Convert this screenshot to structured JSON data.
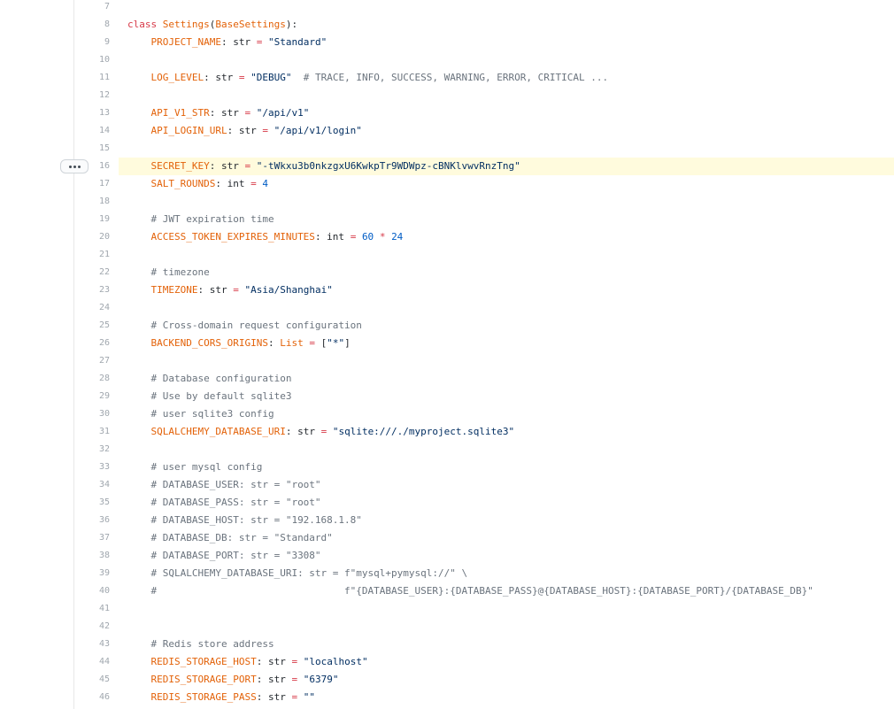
{
  "colors": {
    "keyword": "#d73a49",
    "entity": "#e36209",
    "string": "#032f62",
    "number": "#005cc5",
    "comment": "#6a737d",
    "highlight_bg": "#fffbdd",
    "line_number": "#a0a7ae"
  },
  "highlighted_line": 16,
  "line_actions": {
    "icon": "kebab-horizontal-icon"
  },
  "lines": [
    {
      "num": "7",
      "tokens": []
    },
    {
      "num": "8",
      "tokens": [
        {
          "t": "kw",
          "v": "class "
        },
        {
          "t": "ent",
          "v": "Settings"
        },
        {
          "t": "plain",
          "v": "("
        },
        {
          "t": "ent",
          "v": "BaseSettings"
        },
        {
          "t": "plain",
          "v": "):"
        }
      ]
    },
    {
      "num": "9",
      "tokens": [
        {
          "t": "plain",
          "v": "    "
        },
        {
          "t": "ent",
          "v": "PROJECT_NAME"
        },
        {
          "t": "plain",
          "v": ": str "
        },
        {
          "t": "op",
          "v": "="
        },
        {
          "t": "plain",
          "v": " "
        },
        {
          "t": "str",
          "v": "\"Standard\""
        }
      ]
    },
    {
      "num": "10",
      "tokens": []
    },
    {
      "num": "11",
      "tokens": [
        {
          "t": "plain",
          "v": "    "
        },
        {
          "t": "ent",
          "v": "LOG_LEVEL"
        },
        {
          "t": "plain",
          "v": ": str "
        },
        {
          "t": "op",
          "v": "="
        },
        {
          "t": "plain",
          "v": " "
        },
        {
          "t": "str",
          "v": "\"DEBUG\""
        },
        {
          "t": "plain",
          "v": "  "
        },
        {
          "t": "cmt",
          "v": "# TRACE, INFO, SUCCESS, WARNING, ERROR, CRITICAL ..."
        }
      ]
    },
    {
      "num": "12",
      "tokens": []
    },
    {
      "num": "13",
      "tokens": [
        {
          "t": "plain",
          "v": "    "
        },
        {
          "t": "ent",
          "v": "API_V1_STR"
        },
        {
          "t": "plain",
          "v": ": str "
        },
        {
          "t": "op",
          "v": "="
        },
        {
          "t": "plain",
          "v": " "
        },
        {
          "t": "str",
          "v": "\"/api/v1\""
        }
      ]
    },
    {
      "num": "14",
      "tokens": [
        {
          "t": "plain",
          "v": "    "
        },
        {
          "t": "ent",
          "v": "API_LOGIN_URL"
        },
        {
          "t": "plain",
          "v": ": str "
        },
        {
          "t": "op",
          "v": "="
        },
        {
          "t": "plain",
          "v": " "
        },
        {
          "t": "str",
          "v": "\"/api/v1/login\""
        }
      ]
    },
    {
      "num": "15",
      "tokens": []
    },
    {
      "num": "16",
      "tokens": [
        {
          "t": "plain",
          "v": "    "
        },
        {
          "t": "ent",
          "v": "SECRET_KEY"
        },
        {
          "t": "plain",
          "v": ": str "
        },
        {
          "t": "op",
          "v": "="
        },
        {
          "t": "plain",
          "v": " "
        },
        {
          "t": "str",
          "v": "\"-tWkxu3b0nkzgxU6KwkpTr9WDWpz-cBNKlvwvRnzTng\""
        }
      ]
    },
    {
      "num": "17",
      "tokens": [
        {
          "t": "plain",
          "v": "    "
        },
        {
          "t": "ent",
          "v": "SALT_ROUNDS"
        },
        {
          "t": "plain",
          "v": ": int "
        },
        {
          "t": "op",
          "v": "="
        },
        {
          "t": "plain",
          "v": " "
        },
        {
          "t": "num",
          "v": "4"
        }
      ]
    },
    {
      "num": "18",
      "tokens": []
    },
    {
      "num": "19",
      "tokens": [
        {
          "t": "plain",
          "v": "    "
        },
        {
          "t": "cmt",
          "v": "# JWT expiration time"
        }
      ]
    },
    {
      "num": "20",
      "tokens": [
        {
          "t": "plain",
          "v": "    "
        },
        {
          "t": "ent",
          "v": "ACCESS_TOKEN_EXPIRES_MINUTES"
        },
        {
          "t": "plain",
          "v": ": int "
        },
        {
          "t": "op",
          "v": "="
        },
        {
          "t": "plain",
          "v": " "
        },
        {
          "t": "num",
          "v": "60"
        },
        {
          "t": "plain",
          "v": " "
        },
        {
          "t": "op",
          "v": "*"
        },
        {
          "t": "plain",
          "v": " "
        },
        {
          "t": "num",
          "v": "24"
        }
      ]
    },
    {
      "num": "21",
      "tokens": []
    },
    {
      "num": "22",
      "tokens": [
        {
          "t": "plain",
          "v": "    "
        },
        {
          "t": "cmt",
          "v": "# timezone"
        }
      ]
    },
    {
      "num": "23",
      "tokens": [
        {
          "t": "plain",
          "v": "    "
        },
        {
          "t": "ent",
          "v": "TIMEZONE"
        },
        {
          "t": "plain",
          "v": ": str "
        },
        {
          "t": "op",
          "v": "="
        },
        {
          "t": "plain",
          "v": " "
        },
        {
          "t": "str",
          "v": "\"Asia/Shanghai\""
        }
      ]
    },
    {
      "num": "24",
      "tokens": []
    },
    {
      "num": "25",
      "tokens": [
        {
          "t": "plain",
          "v": "    "
        },
        {
          "t": "cmt",
          "v": "# Cross-domain request configuration"
        }
      ]
    },
    {
      "num": "26",
      "tokens": [
        {
          "t": "plain",
          "v": "    "
        },
        {
          "t": "ent",
          "v": "BACKEND_CORS_ORIGINS"
        },
        {
          "t": "plain",
          "v": ": "
        },
        {
          "t": "ent",
          "v": "List"
        },
        {
          "t": "plain",
          "v": " "
        },
        {
          "t": "op",
          "v": "="
        },
        {
          "t": "plain",
          "v": " ["
        },
        {
          "t": "str",
          "v": "\"*\""
        },
        {
          "t": "plain",
          "v": "]"
        }
      ]
    },
    {
      "num": "27",
      "tokens": []
    },
    {
      "num": "28",
      "tokens": [
        {
          "t": "plain",
          "v": "    "
        },
        {
          "t": "cmt",
          "v": "# Database configuration"
        }
      ]
    },
    {
      "num": "29",
      "tokens": [
        {
          "t": "plain",
          "v": "    "
        },
        {
          "t": "cmt",
          "v": "# Use by default sqlite3"
        }
      ]
    },
    {
      "num": "30",
      "tokens": [
        {
          "t": "plain",
          "v": "    "
        },
        {
          "t": "cmt",
          "v": "# user sqlite3 config"
        }
      ]
    },
    {
      "num": "31",
      "tokens": [
        {
          "t": "plain",
          "v": "    "
        },
        {
          "t": "ent",
          "v": "SQLALCHEMY_DATABASE_URI"
        },
        {
          "t": "plain",
          "v": ": str "
        },
        {
          "t": "op",
          "v": "="
        },
        {
          "t": "plain",
          "v": " "
        },
        {
          "t": "str",
          "v": "\"sqlite:///./myproject.sqlite3\""
        }
      ]
    },
    {
      "num": "32",
      "tokens": []
    },
    {
      "num": "33",
      "tokens": [
        {
          "t": "plain",
          "v": "    "
        },
        {
          "t": "cmt",
          "v": "# user mysql config"
        }
      ]
    },
    {
      "num": "34",
      "tokens": [
        {
          "t": "plain",
          "v": "    "
        },
        {
          "t": "cmt",
          "v": "# DATABASE_USER: str = \"root\""
        }
      ]
    },
    {
      "num": "35",
      "tokens": [
        {
          "t": "plain",
          "v": "    "
        },
        {
          "t": "cmt",
          "v": "# DATABASE_PASS: str = \"root\""
        }
      ]
    },
    {
      "num": "36",
      "tokens": [
        {
          "t": "plain",
          "v": "    "
        },
        {
          "t": "cmt",
          "v": "# DATABASE_HOST: str = \"192.168.1.8\""
        }
      ]
    },
    {
      "num": "37",
      "tokens": [
        {
          "t": "plain",
          "v": "    "
        },
        {
          "t": "cmt",
          "v": "# DATABASE_DB: str = \"Standard\""
        }
      ]
    },
    {
      "num": "38",
      "tokens": [
        {
          "t": "plain",
          "v": "    "
        },
        {
          "t": "cmt",
          "v": "# DATABASE_PORT: str = \"3308\""
        }
      ]
    },
    {
      "num": "39",
      "tokens": [
        {
          "t": "plain",
          "v": "    "
        },
        {
          "t": "cmt",
          "v": "# SQLALCHEMY_DATABASE_URI: str = f\"mysql+pymysql://\" \\"
        }
      ]
    },
    {
      "num": "40",
      "tokens": [
        {
          "t": "plain",
          "v": "    "
        },
        {
          "t": "cmt",
          "v": "#                                f\"{DATABASE_USER}:{DATABASE_PASS}@{DATABASE_HOST}:{DATABASE_PORT}/{DATABASE_DB}\""
        }
      ]
    },
    {
      "num": "41",
      "tokens": []
    },
    {
      "num": "42",
      "tokens": []
    },
    {
      "num": "43",
      "tokens": [
        {
          "t": "plain",
          "v": "    "
        },
        {
          "t": "cmt",
          "v": "# Redis store address"
        }
      ]
    },
    {
      "num": "44",
      "tokens": [
        {
          "t": "plain",
          "v": "    "
        },
        {
          "t": "ent",
          "v": "REDIS_STORAGE_HOST"
        },
        {
          "t": "plain",
          "v": ": str "
        },
        {
          "t": "op",
          "v": "="
        },
        {
          "t": "plain",
          "v": " "
        },
        {
          "t": "str",
          "v": "\"localhost\""
        }
      ]
    },
    {
      "num": "45",
      "tokens": [
        {
          "t": "plain",
          "v": "    "
        },
        {
          "t": "ent",
          "v": "REDIS_STORAGE_PORT"
        },
        {
          "t": "plain",
          "v": ": str "
        },
        {
          "t": "op",
          "v": "="
        },
        {
          "t": "plain",
          "v": " "
        },
        {
          "t": "str",
          "v": "\"6379\""
        }
      ]
    },
    {
      "num": "46",
      "tokens": [
        {
          "t": "plain",
          "v": "    "
        },
        {
          "t": "ent",
          "v": "REDIS_STORAGE_PASS"
        },
        {
          "t": "plain",
          "v": ": str "
        },
        {
          "t": "op",
          "v": "="
        },
        {
          "t": "plain",
          "v": " "
        },
        {
          "t": "str",
          "v": "\"\""
        }
      ]
    }
  ]
}
